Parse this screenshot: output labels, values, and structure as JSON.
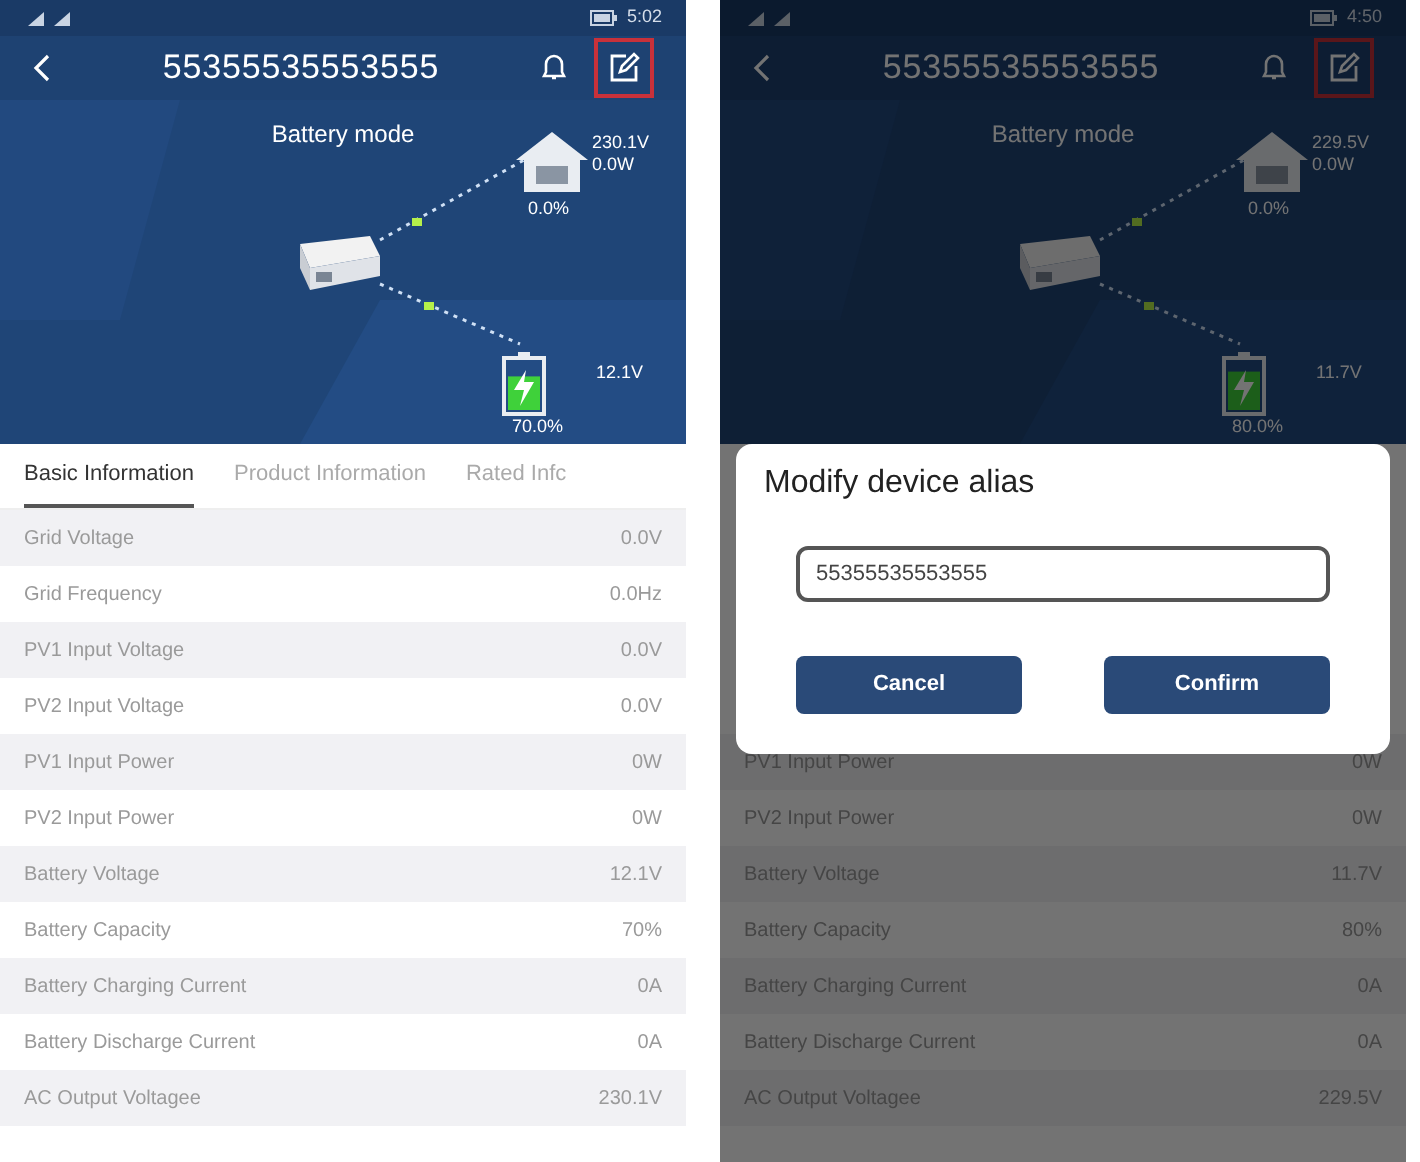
{
  "screens": [
    {
      "status_time": "5:02",
      "title": "55355535553555",
      "mode": "Battery mode",
      "load": {
        "voltage": "230.1V",
        "power": "0.0W",
        "percent": "0.0%"
      },
      "battery": {
        "voltage": "12.1V",
        "percent": "70.0%",
        "level": 0.7
      },
      "edit_highlighted": true,
      "dimmed": false,
      "tabs": [
        {
          "label": "Basic Information",
          "selected": true
        },
        {
          "label": "Product Information",
          "selected": false
        },
        {
          "label": "Rated Infc",
          "selected": false
        }
      ],
      "rows": [
        {
          "label": "Grid Voltage",
          "value": "0.0V"
        },
        {
          "label": "Grid Frequency",
          "value": "0.0Hz"
        },
        {
          "label": "PV1 Input Voltage",
          "value": "0.0V"
        },
        {
          "label": "PV2 Input Voltage",
          "value": "0.0V"
        },
        {
          "label": "PV1 Input Power",
          "value": "0W"
        },
        {
          "label": "PV2 Input Power",
          "value": "0W"
        },
        {
          "label": "Battery Voltage",
          "value": "12.1V"
        },
        {
          "label": "Battery Capacity",
          "value": "70%"
        },
        {
          "label": "Battery Charging Current",
          "value": "0A"
        },
        {
          "label": "Battery Discharge Current",
          "value": "0A"
        },
        {
          "label": "AC Output Voltagee",
          "value": "230.1V"
        }
      ]
    },
    {
      "status_time": "4:50",
      "title": "55355535553555",
      "mode": "Battery mode",
      "load": {
        "voltage": "229.5V",
        "power": "0.0W",
        "percent": "0.0%"
      },
      "battery": {
        "voltage": "11.7V",
        "percent": "80.0%",
        "level": 0.8
      },
      "edit_highlighted": true,
      "dimmed": true,
      "rows": [
        {
          "label": "PV1 Input Power",
          "value": "0W"
        },
        {
          "label": "PV2 Input Power",
          "value": "0W"
        },
        {
          "label": "Battery Voltage",
          "value": "11.7V"
        },
        {
          "label": "Battery Capacity",
          "value": "80%"
        },
        {
          "label": "Battery Charging Current",
          "value": "0A"
        },
        {
          "label": "Battery Discharge Current",
          "value": "0A"
        },
        {
          "label": "AC Output Voltagee",
          "value": "229.5V"
        }
      ],
      "dialog": {
        "title": "Modify device alias",
        "value": "55355535553555",
        "buttons": [
          "Cancel",
          "Confirm"
        ]
      }
    }
  ]
}
